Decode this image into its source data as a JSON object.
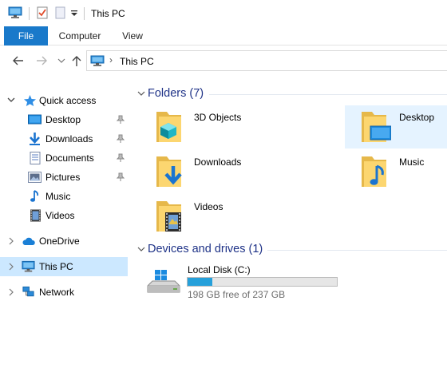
{
  "window": {
    "title": "This PC"
  },
  "ribbon": {
    "tabs": [
      "File",
      "Computer",
      "View"
    ]
  },
  "address": {
    "path": "This PC"
  },
  "nav": {
    "quick_access": "Quick access",
    "items": [
      {
        "label": "Desktop",
        "pinned": true
      },
      {
        "label": "Downloads",
        "pinned": true
      },
      {
        "label": "Documents",
        "pinned": true
      },
      {
        "label": "Pictures",
        "pinned": true
      },
      {
        "label": "Music",
        "pinned": false
      },
      {
        "label": "Videos",
        "pinned": false
      }
    ],
    "onedrive": "OneDrive",
    "this_pc": "This PC",
    "network": "Network"
  },
  "content": {
    "folders_header": "Folders (7)",
    "folders": [
      {
        "name": "3D Objects",
        "icon": "3d-objects-folder-icon"
      },
      {
        "name": "Desktop",
        "icon": "desktop-folder-icon",
        "selected": true
      },
      {
        "name": "Downloads",
        "icon": "downloads-folder-icon"
      },
      {
        "name": "Music",
        "icon": "music-folder-icon"
      },
      {
        "name": "Videos",
        "icon": "videos-folder-icon"
      }
    ],
    "devices_header": "Devices and drives (1)",
    "drive": {
      "name": "Local Disk (C:)",
      "free_text": "198 GB free of 237 GB",
      "used_fraction": 0.165
    }
  },
  "colors": {
    "accent": "#1979ca",
    "selection": "#cce8ff",
    "group_header": "#1e3287",
    "drive_fill": "#26a0da"
  }
}
